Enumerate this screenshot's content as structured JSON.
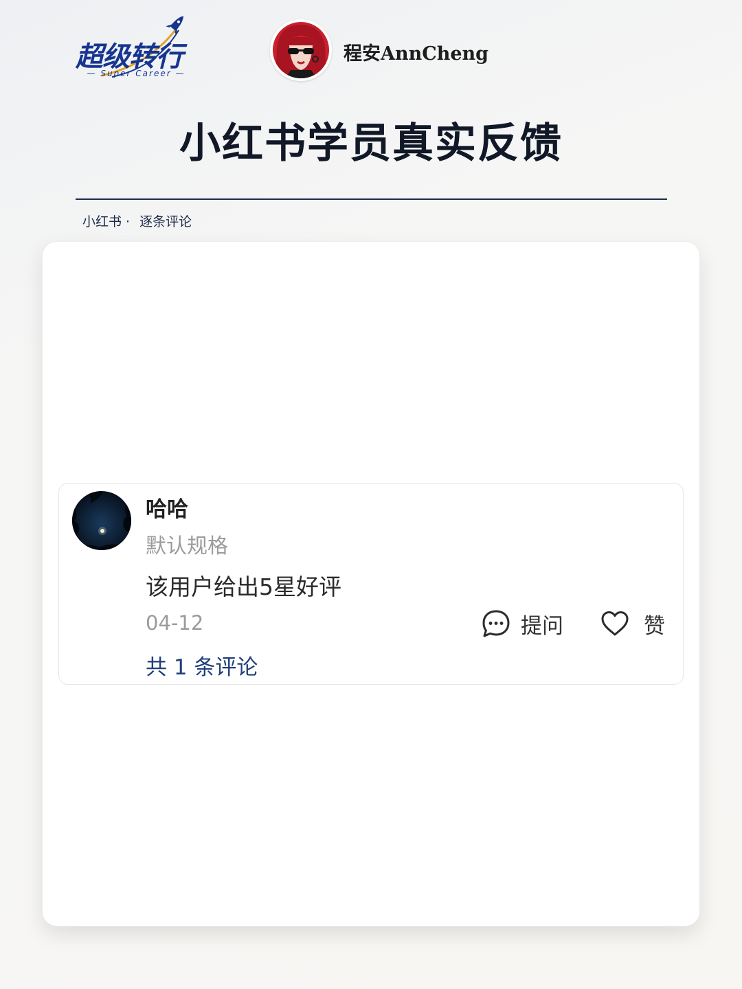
{
  "brand": {
    "logo_text": "超级转行",
    "logo_subtext": "— Super Career —"
  },
  "author": {
    "name": "程安AnnCheng"
  },
  "page": {
    "title": "小红书学员真实反馈",
    "breadcrumb": {
      "source": "小红书",
      "separator": "·",
      "section": "逐条评论"
    }
  },
  "comment": {
    "user_name": "哈哈",
    "variant": "默认规格",
    "text": "该用户给出5星好评",
    "date": "04-12",
    "ask_label": "提问",
    "like_label": "赞",
    "reply_count": "共 1 条评论"
  },
  "colors": {
    "brand_blue": "#16358f",
    "title_dark": "#111827",
    "link_blue": "#1f3f7a",
    "muted_gray": "#9b9b9b"
  },
  "icons": [
    "rocket-icon",
    "chat-bubble-icon",
    "heart-icon"
  ]
}
